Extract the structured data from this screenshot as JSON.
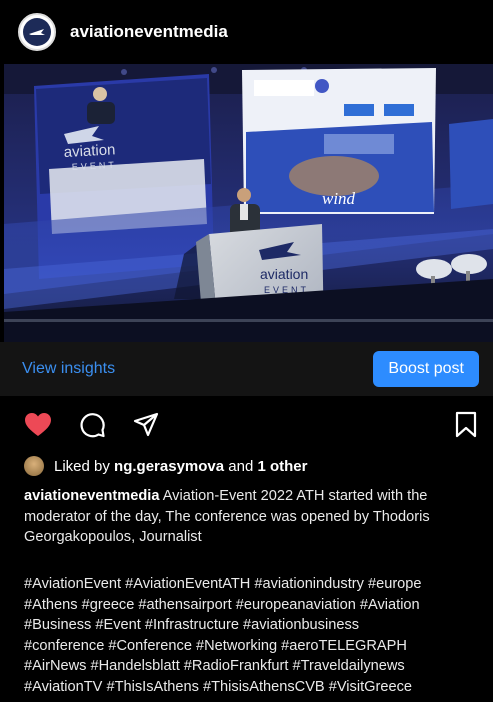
{
  "post": {
    "username": "aviationeventmedia",
    "photo": {
      "podium_brand_line1": "aviation",
      "podium_brand_line2": "EVENT",
      "screen_brand_line1": "aviation",
      "screen_brand_line2": "EVENT",
      "screen_slide_word": "wind"
    },
    "insights_label": "View insights",
    "boost_label": "Boost post",
    "likes": {
      "prefix": "Liked by",
      "user": "ng.gerasymova",
      "middle": "and",
      "others": "1 other"
    },
    "caption": {
      "author": "aviationeventmedia",
      "text": "Aviation-Event 2022 ATH started with the moderator of the day, The conference was opened by Thodoris Georgakopoulos, Journalist"
    },
    "hashtag_lines": [
      "#AviationEvent #AviationEventATH #aviationindustry #europe",
      "#Athens #greece #athensairport #europeanaviation #Aviation",
      "#Business #Event #Infrastructure #aviationbusiness",
      "#conference #Conference #Networking #aeroTELEGRAPH",
      "#AirNews #Handelsblatt #RadioFrankfurt #Traveldailynews",
      "#AviationTV #ThisIsAthens #ThisisAthensCVB #VisitGreece"
    ]
  },
  "colors": {
    "like_heart": "#ed4956",
    "link_blue": "#3b8ff0",
    "boost_bg": "#2d8cff"
  },
  "icons": [
    "heart-icon",
    "comment-icon",
    "share-icon",
    "bookmark-icon"
  ]
}
